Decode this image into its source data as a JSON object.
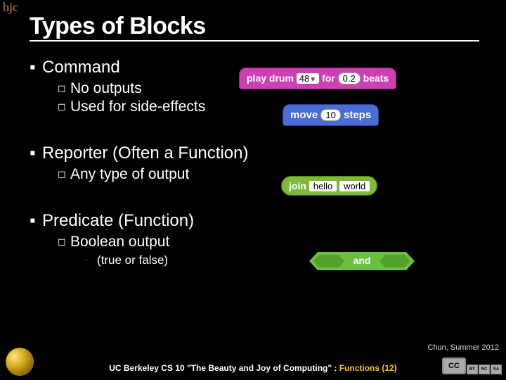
{
  "logo_text": "bjc",
  "title": "Types of Blocks",
  "bullets": {
    "b1": {
      "label": "Command",
      "subs": {
        "s1": "No outputs",
        "s2": "Used for side-effects"
      }
    },
    "b2": {
      "label": "Reporter (Often a Function)",
      "subs": {
        "s1": "Any type of output"
      }
    },
    "b3": {
      "label": "Predicate (Function)",
      "subs": {
        "s1": "Boolean output",
        "subsubs": {
          "t1": "(true or false)"
        }
      }
    }
  },
  "blocks": {
    "play_drum": {
      "pre": "play drum",
      "drum_value": "48",
      "mid": "for",
      "beats_value": "0.2",
      "post": "beats"
    },
    "move": {
      "pre": "move",
      "steps_value": "10",
      "post": "steps"
    },
    "join": {
      "label": "join",
      "arg1": "hello",
      "arg2": "world"
    },
    "and": {
      "label": "and"
    }
  },
  "footer": {
    "author": "Chun, Summer 2012",
    "course_pre": "UC Berkeley CS 10 \"The Beauty and Joy of Computing\" : ",
    "course_topic": "Functions",
    "course_post": " (12)",
    "cc_main": "CC",
    "cc_by": "BY",
    "cc_nc": "NC",
    "cc_sa": "SA"
  }
}
